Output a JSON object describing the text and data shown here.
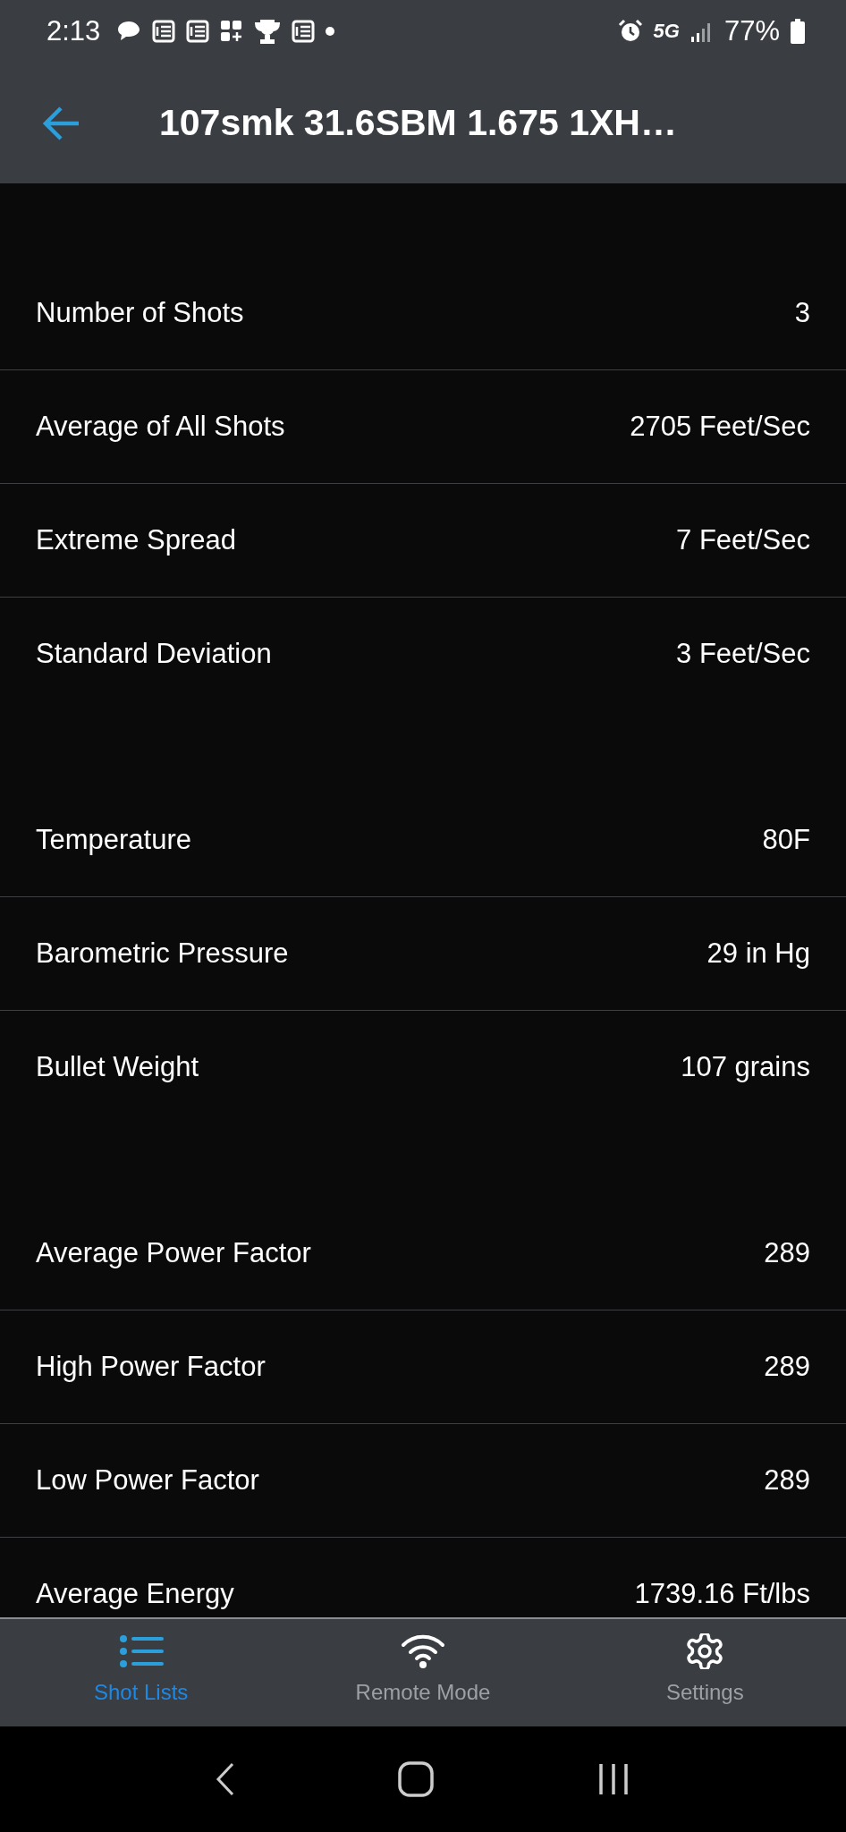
{
  "status_bar": {
    "time": "2:13",
    "network": "5G",
    "battery": "77%"
  },
  "header": {
    "title": "107smk 31.6SBM 1.675 1XH…"
  },
  "groups": [
    {
      "rows": [
        {
          "label": "Number of Shots",
          "value": "3"
        },
        {
          "label": "Average of All Shots",
          "value": "2705 Feet/Sec"
        },
        {
          "label": "Extreme Spread",
          "value": "7 Feet/Sec"
        },
        {
          "label": "Standard Deviation",
          "value": "3 Feet/Sec"
        }
      ]
    },
    {
      "rows": [
        {
          "label": "Temperature",
          "value": "80F"
        },
        {
          "label": "Barometric Pressure",
          "value": "29 in Hg"
        },
        {
          "label": "Bullet Weight",
          "value": "107 grains"
        }
      ]
    },
    {
      "rows": [
        {
          "label": "Average Power Factor",
          "value": "289"
        },
        {
          "label": "High Power Factor",
          "value": "289"
        },
        {
          "label": "Low Power Factor",
          "value": "289"
        },
        {
          "label": "Average Energy",
          "value": "1739.16 Ft/lbs"
        }
      ]
    }
  ],
  "bottom_nav": [
    {
      "kind": "list",
      "label": "Shot Lists",
      "selected": true
    },
    {
      "kind": "wifi",
      "label": "Remote Mode",
      "selected": false
    },
    {
      "kind": "gear",
      "label": "Settings",
      "selected": false
    }
  ]
}
